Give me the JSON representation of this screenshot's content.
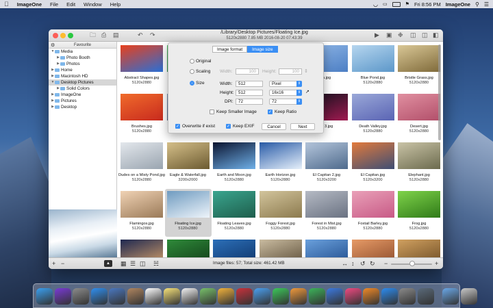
{
  "menubar": {
    "app_name": "ImageOne",
    "menus": [
      "File",
      "Edit",
      "Window",
      "Help"
    ],
    "clock": "Fri 8:56 PM",
    "user": "ImageOne"
  },
  "window": {
    "path": "/Library/Desktop Pictures/Floating Ice.jpg",
    "info": "5120x2880   7.85 MB   2016-08-20 07:43:39"
  },
  "sidebar": {
    "header": "Favourite",
    "items": [
      {
        "label": "Media",
        "expanded": true,
        "indent": 0
      },
      {
        "label": "Photo Booth",
        "expanded": false,
        "indent": 1
      },
      {
        "label": "Photos",
        "expanded": false,
        "indent": 1
      },
      {
        "label": "Home",
        "expanded": false,
        "indent": 0
      },
      {
        "label": "Macintosh HD",
        "expanded": false,
        "indent": 0
      },
      {
        "label": "Desktop Pictures",
        "expanded": true,
        "indent": 0,
        "selected": true
      },
      {
        "label": "Solid Colors",
        "expanded": false,
        "indent": 1
      },
      {
        "label": "ImageOne",
        "expanded": false,
        "indent": 0
      },
      {
        "label": "Pictures",
        "expanded": false,
        "indent": 0
      },
      {
        "label": "Desktop",
        "expanded": false,
        "indent": 0
      }
    ]
  },
  "grid": {
    "images": [
      {
        "name": "Abstract Shapes.jpg",
        "size": "5120x2880",
        "colors": [
          "#e8401c",
          "#2a6fd6"
        ]
      },
      {
        "name": "",
        "size": "",
        "colors": [
          "#45b85c",
          "#1f7a3b"
        ]
      },
      {
        "name": "",
        "size": "",
        "colors": [
          "#d0d0d0",
          "#d0d0d0"
        ]
      },
      {
        "name": "",
        "size": "",
        "colors": [
          "#d0d0d0",
          "#d0d0d0"
        ]
      },
      {
        "name": "h.jpg",
        "size": "",
        "colors": [
          "#8fb6e6",
          "#4d7fc4"
        ]
      },
      {
        "name": "Blue Pond.jpg",
        "size": "5120x2880",
        "colors": [
          "#b6d6ef",
          "#5c97c9"
        ]
      },
      {
        "name": "Bristle Grass.jpg",
        "size": "5120x2880",
        "colors": [
          "#d9c796",
          "#7f6a3a"
        ]
      },
      {
        "name": "Brushes.jpg",
        "size": "5120x2880",
        "colors": [
          "#f06b2b",
          "#c82a1e"
        ]
      },
      {
        "name": "",
        "size": "",
        "colors": [
          "#7a8fb0",
          "#32466b"
        ]
      },
      {
        "name": "",
        "size": "",
        "colors": [
          "#d0d0d0",
          "#d0d0d0"
        ]
      },
      {
        "name": "",
        "size": "",
        "colors": [
          "#d0d0d0",
          "#d0d0d0"
        ]
      },
      {
        "name": "nt 3.jpg",
        "size": "",
        "colors": [
          "#10121d",
          "#a01a50"
        ]
      },
      {
        "name": "Death Valley.jpg",
        "size": "5120x2880",
        "colors": [
          "#9aa8d8",
          "#5a64b4"
        ]
      },
      {
        "name": "Desert.jpg",
        "size": "5120x2880",
        "colors": [
          "#e08fa0",
          "#b24f6a"
        ]
      },
      {
        "name": "Dudes on a Misty Pond.jpg",
        "size": "5120x2880",
        "colors": [
          "#e3e7ec",
          "#9aa5b0"
        ]
      },
      {
        "name": "Eagle & Waterfall.jpg",
        "size": "3200x2000",
        "colors": [
          "#d6c08a",
          "#6b5a30"
        ]
      },
      {
        "name": "Earth and Moon.jpg",
        "size": "5120x2880",
        "colors": [
          "#0b1430",
          "#6fb0e8"
        ]
      },
      {
        "name": "Earth Horizon.jpg",
        "size": "5120x2880",
        "colors": [
          "#2a5ca8",
          "#e6f0fa"
        ]
      },
      {
        "name": "El Capitan 2.jpg",
        "size": "5120x3200",
        "colors": [
          "#b5c6dc",
          "#4e6a8c"
        ]
      },
      {
        "name": "El Capitan.jpg",
        "size": "5120x3200",
        "colors": [
          "#e27a3c",
          "#3e4e74"
        ]
      },
      {
        "name": "Elephant.jpg",
        "size": "5120x2880",
        "colors": [
          "#c9c3a6",
          "#6c6b4e"
        ]
      },
      {
        "name": "Flamingos.jpg",
        "size": "5120x2880",
        "colors": [
          "#f0d2b4",
          "#9a7a58"
        ]
      },
      {
        "name": "Floating Ice.jpg",
        "size": "5120x2880",
        "colors": [
          "#6f9bc0",
          "#eef4fa"
        ]
      },
      {
        "name": "Floating Leaves.jpg",
        "size": "5120x2880",
        "colors": [
          "#3aa58e",
          "#1e5e4c"
        ]
      },
      {
        "name": "Foggy Forest.jpg",
        "size": "5120x2880",
        "colors": [
          "#d2c49c",
          "#8c7a4e"
        ]
      },
      {
        "name": "Forest in Mist.jpg",
        "size": "5120x2880",
        "colors": [
          "#b5bac4",
          "#6a7282"
        ]
      },
      {
        "name": "Foxtail Barley.jpg",
        "size": "5120x2880",
        "colors": [
          "#e9a0b8",
          "#c85a86"
        ]
      },
      {
        "name": "Frog.jpg",
        "size": "5120x2880",
        "colors": [
          "#7fd34a",
          "#2f7a18"
        ]
      },
      {
        "name": "",
        "size": "",
        "colors": [
          "#1e2850",
          "#d8a26a"
        ]
      },
      {
        "name": "",
        "size": "",
        "colors": [
          "#2f8a3a",
          "#0f3a16"
        ]
      },
      {
        "name": "",
        "size": "",
        "colors": [
          "#2c6fb8",
          "#0d3266"
        ]
      },
      {
        "name": "",
        "size": "",
        "colors": [
          "#c9bba0",
          "#5a4c36"
        ]
      },
      {
        "name": "",
        "size": "",
        "colors": [
          "#6aa0dc",
          "#1d4a8a"
        ]
      },
      {
        "name": "",
        "size": "",
        "colors": [
          "#e69a66",
          "#8a4a2a"
        ]
      },
      {
        "name": "",
        "size": "",
        "colors": [
          "#d0a060",
          "#6a4a22"
        ]
      }
    ]
  },
  "status": {
    "text": "Image files: 57;  Total size: 461.42 MB"
  },
  "dialog": {
    "tabs": [
      "Image format",
      "Image size"
    ],
    "active_tab": "Image size",
    "original_label": "Original",
    "scaling_label": "Scaling",
    "size_label": "Size",
    "width_label": "Width:",
    "height_label": "Height:",
    "scale_width": "100",
    "scale_height": "100",
    "size_width_label": "Width:",
    "size_height_label": "Height:",
    "dpi_label": "DPI:",
    "size_width": "512",
    "size_height": "512",
    "dpi": "72",
    "unit": "Pixel",
    "preset": "16x16",
    "dpi_select": "72",
    "keep_smaller": "Keep Smaller Image",
    "keep_ratio": "Keep Ratio",
    "overwrite": "Overwrite if exist",
    "keep_exif": "Keep EXIF",
    "cancel": "Cancel",
    "next": "Next"
  }
}
